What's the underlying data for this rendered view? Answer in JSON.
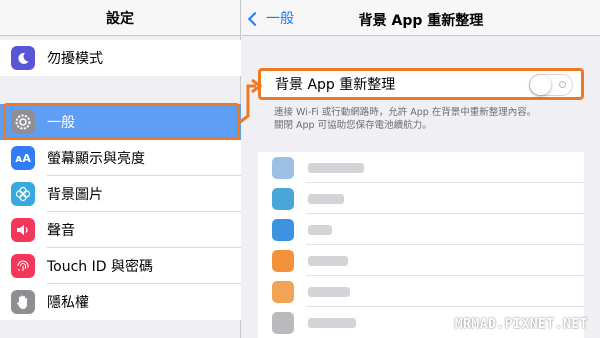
{
  "sidebar": {
    "title": "設定",
    "items": [
      {
        "label": "勿擾模式",
        "icon": "moon-icon",
        "color": "#5856d6",
        "selected": false
      },
      {
        "label": "一般",
        "icon": "gear-icon",
        "color": "#8e8e93",
        "selected": true
      },
      {
        "label": "螢幕顯示與亮度",
        "icon": "text-size-icon",
        "color": "#2f7cf6",
        "selected": false
      },
      {
        "label": "背景圖片",
        "icon": "wallpaper-flower-icon",
        "color": "#36aadc",
        "selected": false
      },
      {
        "label": "聲音",
        "icon": "speaker-icon",
        "color": "#f2375a",
        "selected": false
      },
      {
        "label": "Touch ID 與密碼",
        "icon": "fingerprint-icon",
        "color": "#f2375a",
        "selected": false
      },
      {
        "label": "隱私權",
        "icon": "hand-icon",
        "color": "#8e8e93",
        "selected": false
      }
    ]
  },
  "detail": {
    "back_label": "一般",
    "title": "背景 App 重新整理",
    "toggle_label": "背景 App 重新整理",
    "toggle_on": false,
    "description_line1": "連接 Wi-Fi 或行動網路時，允許 App 在背景中重新整理內容。",
    "description_line2": "關閉 App 可協助您保存電池續航力。"
  },
  "apps": [
    {
      "icon_color": "#9cc0e6"
    },
    {
      "icon_color": "#4aa6d8"
    },
    {
      "icon_color": "#3b92e0"
    },
    {
      "icon_color": "#f4913b"
    },
    {
      "icon_color": "#f2a356"
    }
  ],
  "accent_color": "#f07820",
  "watermark": "MRMAD.PIXNET.NET"
}
